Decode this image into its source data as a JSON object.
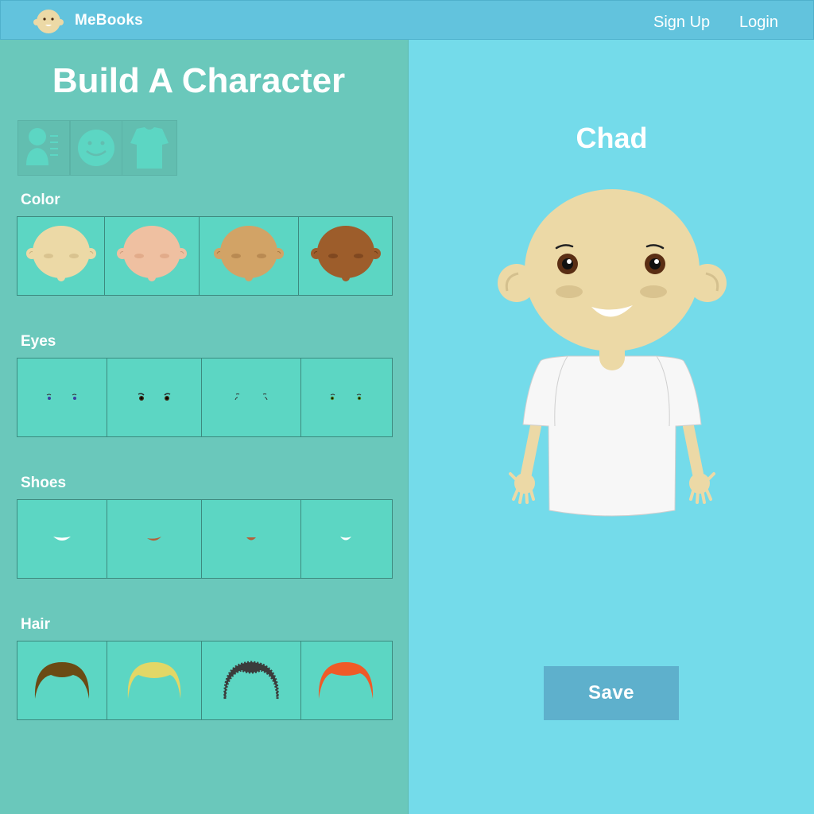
{
  "header": {
    "brand": "MeBooks",
    "signup": "Sign Up",
    "login": "Login"
  },
  "builder": {
    "title": "Build A Character",
    "tabs": [
      "body-tab-icon",
      "face-tab-icon",
      "shirt-tab-icon"
    ],
    "sections": {
      "color": {
        "label": "Color",
        "options": [
          "#ecd9a6",
          "#efc0a1",
          "#d2a366",
          "#9d5d2b"
        ]
      },
      "eyes": {
        "label": "Eyes"
      },
      "shoes": {
        "label": "Shoes"
      },
      "hair": {
        "label": "Hair",
        "options": [
          "#6b4a14",
          "#e2d766",
          "#3b3b3b",
          "#f05a28"
        ]
      }
    }
  },
  "character": {
    "name": "Chad",
    "skin": "#ecd9a6",
    "save_label": "Save"
  },
  "colors": {
    "topbar": "#62c3dd",
    "left_panel": "#6ac8bb",
    "right_panel": "#74dbea",
    "tile": "#5cd6c3",
    "save": "#5eb0cc"
  }
}
